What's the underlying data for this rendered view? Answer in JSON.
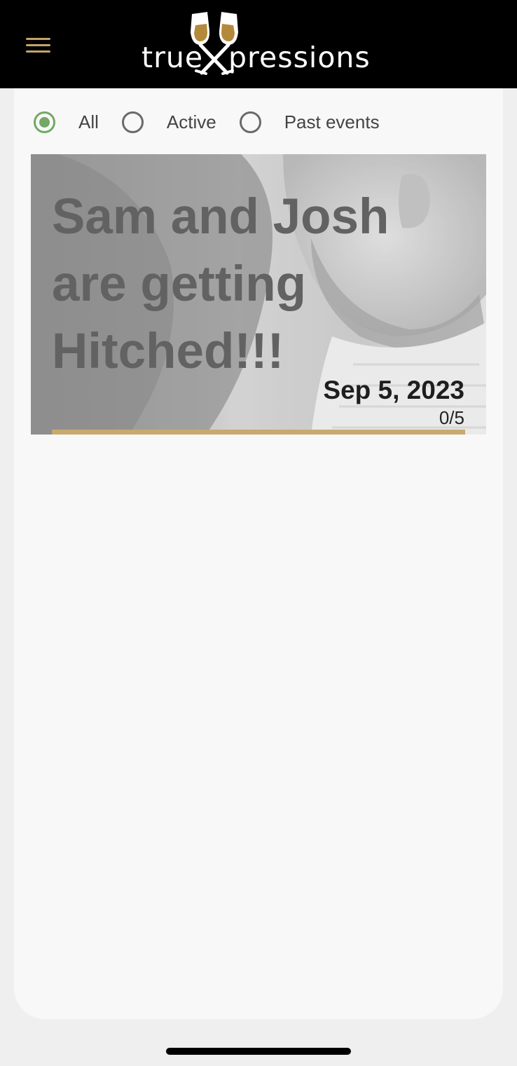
{
  "header": {
    "brand_left": "true",
    "brand_right": "pressions",
    "accent_color": "#c4a36a"
  },
  "filters": [
    {
      "label": "All",
      "selected": true
    },
    {
      "label": "Active",
      "selected": false
    },
    {
      "label": "Past events",
      "selected": false
    }
  ],
  "events": [
    {
      "title": "Sam and Josh are getting Hitched!!!",
      "date": "Sep 5, 2023",
      "count": "0/5",
      "progress": 0
    }
  ],
  "colors": {
    "selected": "#74a864",
    "progress": "#c8a96e"
  }
}
